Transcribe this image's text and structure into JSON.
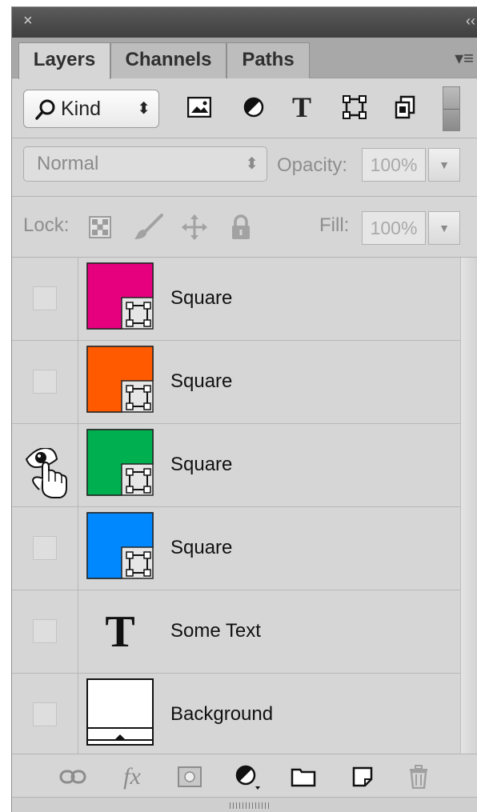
{
  "panel": {
    "close_glyph": "×",
    "collapse_glyph": "‹‹",
    "menu_glyph": "▾≡"
  },
  "tabs": [
    {
      "label": "Layers",
      "active": true
    },
    {
      "label": "Channels",
      "active": false
    },
    {
      "label": "Paths",
      "active": false
    }
  ],
  "filter": {
    "kind_label": "Kind",
    "icons": [
      "pixel-layer-filter-icon",
      "adjustment-layer-filter-icon",
      "type-layer-filter-icon",
      "shape-layer-filter-icon",
      "smart-object-filter-icon"
    ]
  },
  "blend": {
    "mode": "Normal",
    "opacity_label": "Opacity:",
    "opacity_value": "100%"
  },
  "lock": {
    "label": "Lock:",
    "fill_label": "Fill:",
    "fill_value": "100%"
  },
  "layers": [
    {
      "name": "Square",
      "type": "shape",
      "color": "#e6007e",
      "visible": false
    },
    {
      "name": "Square",
      "type": "shape",
      "color": "#ff5a00",
      "visible": false
    },
    {
      "name": "Square",
      "type": "shape",
      "color": "#00b050",
      "visible": true
    },
    {
      "name": "Square",
      "type": "shape",
      "color": "#0088ff",
      "visible": false
    },
    {
      "name": "Some Text",
      "type": "text",
      "visible": false
    },
    {
      "name": "Background",
      "type": "background",
      "color": "#ffffff",
      "visible": false
    }
  ],
  "bottom_icons": [
    "link-layers-icon",
    "fx-icon",
    "layer-mask-icon",
    "adjustment-layer-icon",
    "new-group-icon",
    "new-layer-icon",
    "delete-layer-icon"
  ]
}
